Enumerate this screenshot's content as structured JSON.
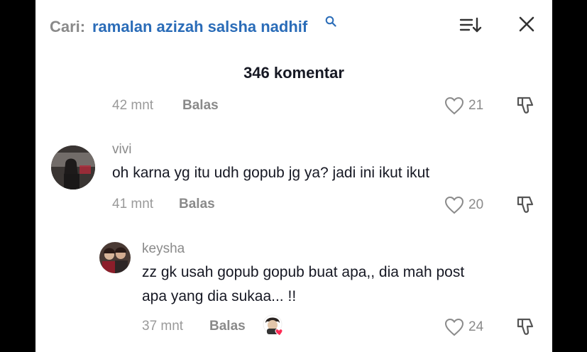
{
  "search": {
    "prefix": "Cari:",
    "term": "ramalan azizah salsha nadhif"
  },
  "header": {
    "count_label": "346 komentar"
  },
  "top_row": {
    "time": "42 mnt",
    "reply": "Balas",
    "likes": "21"
  },
  "comments": [
    {
      "username": "vivi",
      "text": "oh karna yg itu udh gopub jg ya? jadi ini ikut ikut",
      "time": "41 mnt",
      "reply": "Balas",
      "likes": "20"
    },
    {
      "username": "keysha",
      "text_line1": "zz gk usah gopub gopub buat apa,, dia mah post",
      "text_line2": "apa yang dia sukaa... !!",
      "time": "37 mnt",
      "reply": "Balas",
      "likes": "24"
    }
  ],
  "colors": {
    "accent": "#2a6cb8",
    "muted": "#8a8a8a",
    "text": "#161823",
    "heart": "#fe2c55"
  }
}
